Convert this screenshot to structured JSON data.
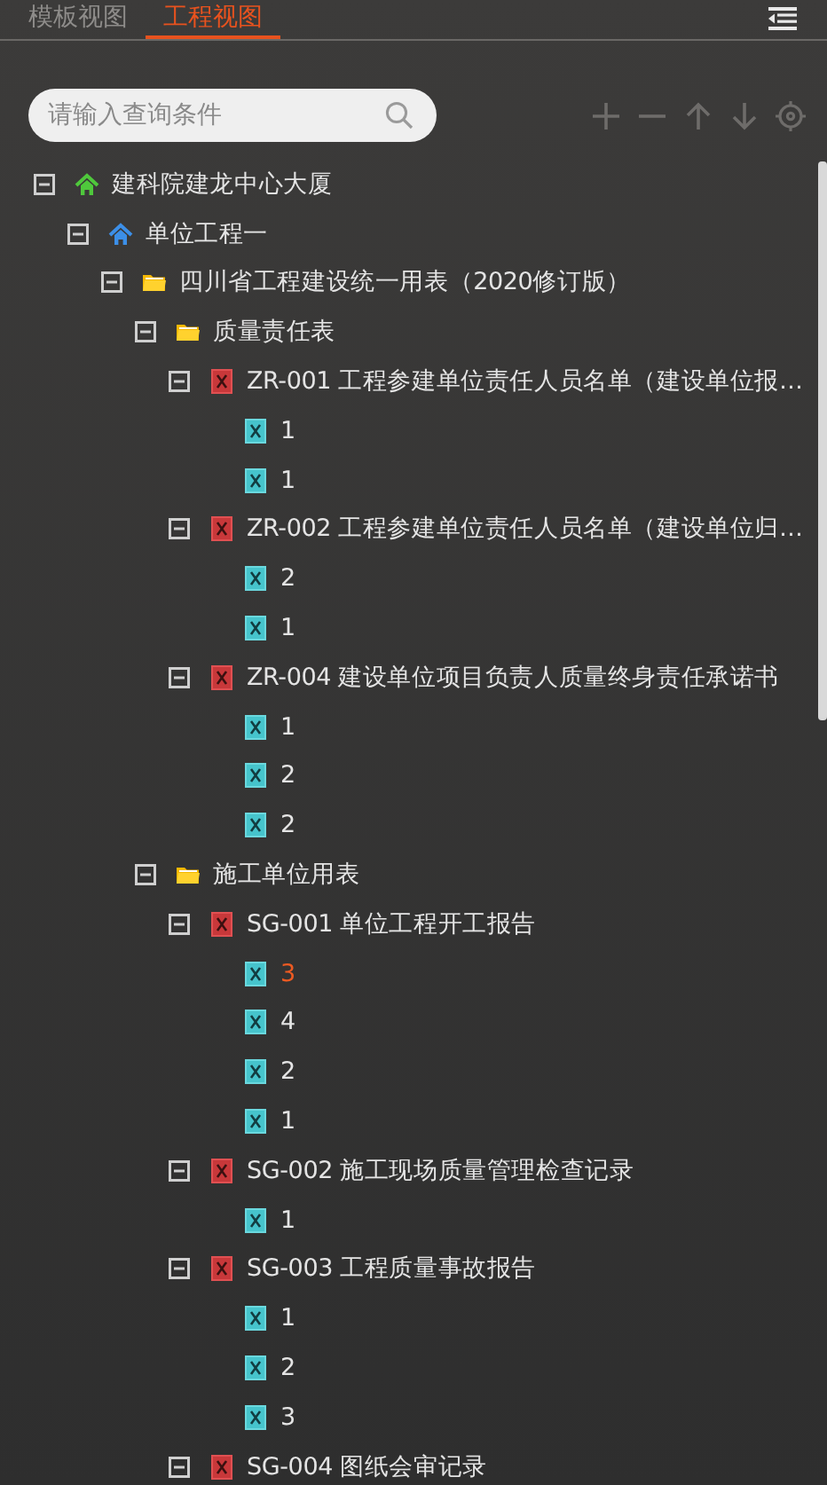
{
  "tabs": [
    {
      "label": "模板视图",
      "selected": false
    },
    {
      "label": "工程视图",
      "selected": true
    }
  ],
  "search": {
    "placeholder": "请输入查询条件"
  },
  "toolbar": [
    {
      "kind": "add",
      "disabled": true
    },
    {
      "kind": "remove",
      "disabled": true
    },
    {
      "kind": "up",
      "disabled": true
    },
    {
      "kind": "down",
      "disabled": true
    },
    {
      "kind": "locate",
      "disabled": true
    }
  ],
  "tree": [
    {
      "kind": "project",
      "label": "建科院建龙中心大厦",
      "expanded": true,
      "children": [
        {
          "kind": "unit",
          "label": "单位工程一",
          "expanded": true,
          "children": [
            {
              "kind": "folder",
              "label": "四川省工程建设统一用表（2020修订版）",
              "expanded": true,
              "children": [
                {
                  "kind": "folder",
                  "label": "质量责任表",
                  "expanded": true,
                  "children": [
                    {
                      "kind": "form",
                      "label": "ZR-001 工程参建单位责任人员名单（建设单位报…",
                      "expanded": true,
                      "children": [
                        {
                          "kind": "record",
                          "label": "1",
                          "selected": false
                        },
                        {
                          "kind": "record",
                          "label": "1",
                          "selected": false
                        }
                      ]
                    },
                    {
                      "kind": "form",
                      "label": "ZR-002 工程参建单位责任人员名单（建设单位归…",
                      "expanded": true,
                      "children": [
                        {
                          "kind": "record",
                          "label": "2",
                          "selected": false
                        },
                        {
                          "kind": "record",
                          "label": "1",
                          "selected": false
                        }
                      ]
                    },
                    {
                      "kind": "form",
                      "label": "ZR-004 建设单位项目负责人质量终身责任承诺书",
                      "expanded": true,
                      "children": [
                        {
                          "kind": "record",
                          "label": "1",
                          "selected": false
                        },
                        {
                          "kind": "record",
                          "label": "2",
                          "selected": false
                        },
                        {
                          "kind": "record",
                          "label": "2",
                          "selected": false
                        }
                      ]
                    }
                  ]
                },
                {
                  "kind": "folder",
                  "label": "施工单位用表",
                  "expanded": true,
                  "children": [
                    {
                      "kind": "form",
                      "label": "SG-001 单位工程开工报告",
                      "expanded": true,
                      "children": [
                        {
                          "kind": "record",
                          "label": "3",
                          "selected": true
                        },
                        {
                          "kind": "record",
                          "label": "4",
                          "selected": false
                        },
                        {
                          "kind": "record",
                          "label": "2",
                          "selected": false
                        },
                        {
                          "kind": "record",
                          "label": "1",
                          "selected": false
                        }
                      ]
                    },
                    {
                      "kind": "form",
                      "label": "SG-002 施工现场质量管理检查记录",
                      "expanded": true,
                      "children": [
                        {
                          "kind": "record",
                          "label": "1",
                          "selected": false
                        }
                      ]
                    },
                    {
                      "kind": "form",
                      "label": "SG-003 工程质量事故报告",
                      "expanded": true,
                      "children": [
                        {
                          "kind": "record",
                          "label": "1",
                          "selected": false
                        },
                        {
                          "kind": "record",
                          "label": "2",
                          "selected": false
                        },
                        {
                          "kind": "record",
                          "label": "3",
                          "selected": false
                        }
                      ]
                    },
                    {
                      "kind": "form",
                      "label": "SG-004 图纸会审记录",
                      "expanded": true
                    }
                  ]
                }
              ]
            }
          ]
        }
      ]
    }
  ]
}
